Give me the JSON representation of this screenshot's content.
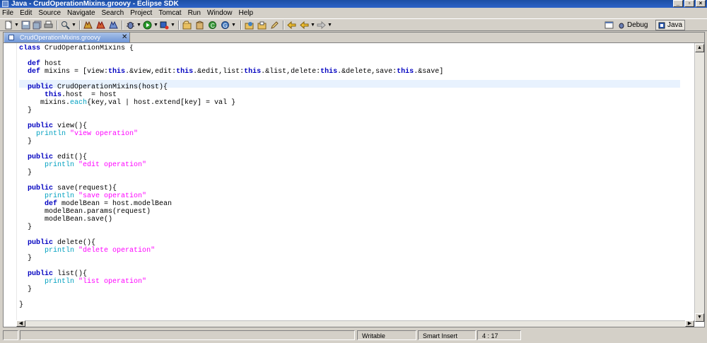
{
  "window": {
    "title": "Java - CrudOperationMixins.groovy - Eclipse SDK",
    "buttons": [
      "_",
      "▫",
      "×"
    ]
  },
  "menu": [
    "File",
    "Edit",
    "Source",
    "Navigate",
    "Search",
    "Project",
    "Tomcat",
    "Run",
    "Window",
    "Help"
  ],
  "perspectives": {
    "debug": "Debug",
    "java": "Java"
  },
  "editor": {
    "tab_label": "CrudOperationMixins.groovy",
    "tab_close": "✕",
    "code_lines": [
      "class CrudOperationMixins {",
      "",
      "  def host",
      "  def mixins = [view:this.&view,edit:this.&edit,list:this.&list,delete:this.&delete,save:this.&save]",
      "",
      "  public CrudOperationMixins(host){",
      "      this.host  = host",
      "     mixins.each{key,val | host.extend[key] = val }",
      "  }",
      "",
      "  public view(){",
      "    println \"view operation\"",
      "  }",
      "",
      "  public edit(){",
      "      println \"edit operation\"",
      "  }",
      "",
      "  public save(request){",
      "      println \"save operation\"",
      "      def modelBean = host.modelBean",
      "      modelBean.params(request)",
      "      modelBean.save()",
      "  }",
      "",
      "  public delete(){",
      "      println \"delete operation\"",
      "  }",
      "",
      "  public list(){",
      "      println \"list operation\"",
      "  }",
      "",
      "}"
    ]
  },
  "status": {
    "mode": "Writable",
    "insert": "Smart Insert",
    "position": "4 : 17"
  }
}
